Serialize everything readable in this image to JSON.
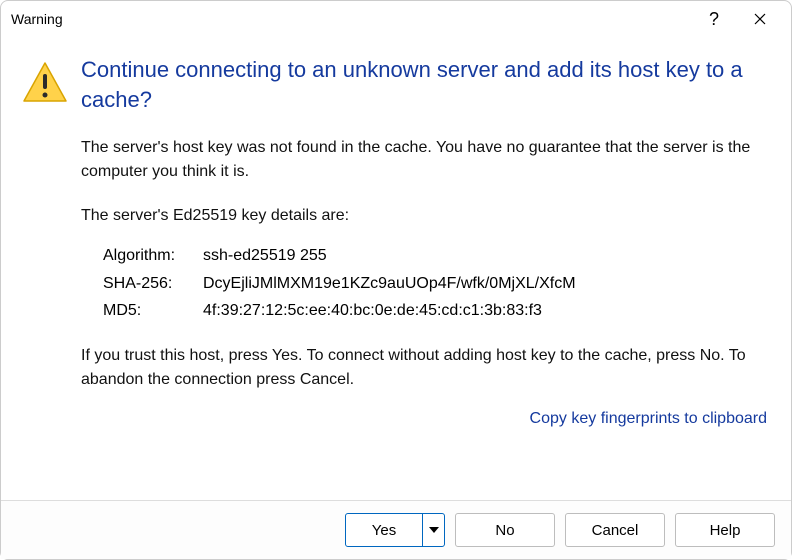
{
  "titlebar": {
    "title": "Warning"
  },
  "dialog": {
    "headline": "Continue connecting to an unknown server and add its host key to a cache?",
    "para1": "The server's host key was not found in the cache. You have no guarantee that the server is the computer you think it is.",
    "para2": "The server's Ed25519 key details are:",
    "details": {
      "algorithm_label": "Algorithm:",
      "algorithm_value": "ssh-ed25519 255",
      "sha256_label": "SHA-256:",
      "sha256_value": "DcyEjliJMlMXM19e1KZc9auUOp4F/wfk/0MjXL/XfcM",
      "md5_label": "MD5:",
      "md5_value": "4f:39:27:12:5c:ee:40:bc:0e:de:45:cd:c1:3b:83:f3"
    },
    "para3": "If you trust this host, press Yes. To connect without adding host key to the cache, press No. To abandon the connection press Cancel.",
    "copy_link": "Copy key fingerprints to clipboard"
  },
  "buttons": {
    "yes": "Yes",
    "no": "No",
    "cancel": "Cancel",
    "help": "Help"
  }
}
